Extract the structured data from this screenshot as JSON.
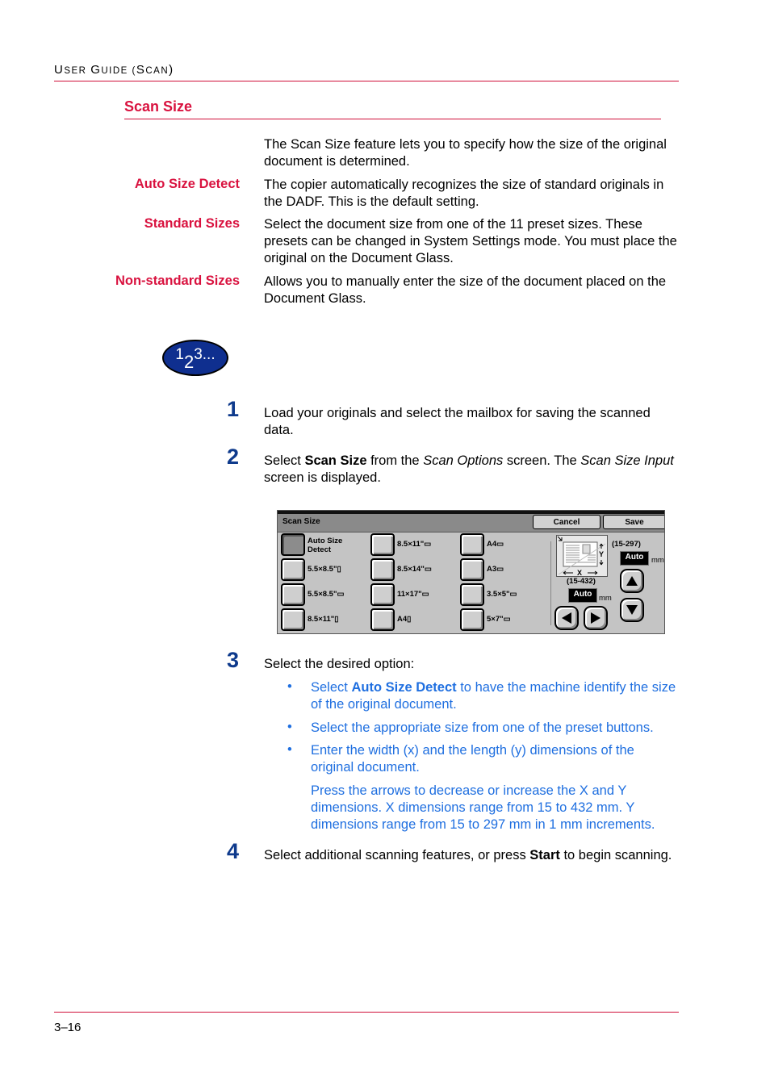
{
  "header": {
    "running_head_parts": [
      "U",
      "SER ",
      "G",
      "UIDE (",
      "S",
      "CAN",
      ")"
    ]
  },
  "section": {
    "title": "Scan Size"
  },
  "intro": "The Scan Size feature lets you to specify how the size of the original document is determined.",
  "definitions": [
    {
      "term": "Auto Size Detect",
      "text": "The copier automatically recognizes the size of standard originals in the DADF.  This is the default setting."
    },
    {
      "term": "Standard Sizes",
      "text": "Select the document size from one of the 11 preset sizes.  These presets can be changed in System Settings mode.  You must place the original on the Document Glass."
    },
    {
      "term": "Non-standard Sizes",
      "text": "Allows you to manually enter the size of the document placed on the Document Glass."
    }
  ],
  "procedure_badge": {
    "d1": "1",
    "d2": "2",
    "d3": "3..."
  },
  "steps": [
    {
      "num": "1",
      "text": "Load your originals and select the mailbox for saving the scanned data."
    },
    {
      "num": "2",
      "parts": [
        "Select ",
        "Scan Size",
        " from the ",
        "Scan Options",
        " screen. The ",
        "Scan Size Input",
        " screen is displayed."
      ]
    },
    {
      "num": "3",
      "text": "Select the desired option:"
    },
    {
      "num": "4",
      "parts": [
        "Select additional scanning features, or press ",
        "Start",
        " to begin scanning."
      ]
    }
  ],
  "options": {
    "bullet": "•",
    "b1": [
      "Select ",
      "Auto Size Detect",
      " to have the machine identify the size of the original document."
    ],
    "b2": "Select the appropriate size from one of the preset buttons.",
    "b3": "Enter the width (x) and the length (y) dimensions of the original document.",
    "note": "Press the arrows to decrease or increase the X and Y dimensions.  X dimensions range from 15 to 432 mm. Y dimensions range from 15 to 297 mm in 1 mm increments."
  },
  "screen": {
    "title": "Scan Size",
    "cancel": "Cancel",
    "save": "Save",
    "auto_detect_l1": "Auto Size",
    "auto_detect_l2": "Detect",
    "presets_col1": [
      "5.5×8.5\"▯",
      "5.5×8.5\"▭",
      "8.5×11\"▯"
    ],
    "presets_col2": [
      "8.5×11\"▭",
      "8.5×14\"▭",
      "11×17\"▭",
      "A4▯"
    ],
    "presets_col3": [
      "A4▭",
      "A3▭",
      "3.5×5\"▭",
      "5×7\"▭"
    ],
    "y_range": "(15-297)",
    "x_range": "(15-432)",
    "y_value": "Auto",
    "x_value": "Auto",
    "unit": "mm",
    "x_label": "X",
    "y_label": "Y"
  },
  "footer": {
    "page": "3–16"
  }
}
